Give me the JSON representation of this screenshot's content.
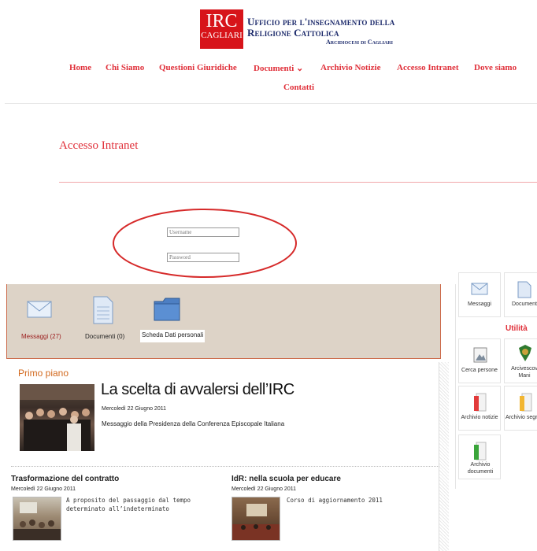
{
  "header": {
    "logo_irc": "IRC",
    "logo_city": "CAGLIARI",
    "title_line1": "Ufficio per l'insegnamento della",
    "title_line2": "Religione Cattolica",
    "title_line3": "Arcidiocesi di Cagliari"
  },
  "nav": {
    "home": "Home",
    "chi_siamo": "Chi Siamo",
    "questioni": "Questioni Giuridiche",
    "documenti": "Documenti ⌄",
    "archivio": "Archivio Notizie",
    "accesso": "Accesso Intranet",
    "dove": "Dove siamo",
    "contatti": "Contatti"
  },
  "page": {
    "title": "Accesso Intranet"
  },
  "login": {
    "username_placeholder": "Username",
    "password_placeholder": "Password"
  },
  "intranet": {
    "messaggi": "Messaggi (27)",
    "documenti": "Documenti (0)",
    "scheda": "Scheda Dati personali"
  },
  "main": {
    "section": "Primo piano",
    "featured": {
      "title": "La scelta di avvalersi dell’IRC",
      "date": "Mercoledì 22 Giugno 2011",
      "desc": "Messaggio della Presidenza della Conferenza Episcopale Italiana"
    },
    "articles": [
      {
        "title": "Trasformazione del contratto",
        "date": "Mercoledì 22 Giugno 2011",
        "desc": "A proposito del passaggio dal tempo determinato all’indeterminato"
      },
      {
        "title": "IdR: nella scuola per educare",
        "date": "Mercoledì 22 Giugno 2011",
        "desc": "Corso di aggiornamento 2011"
      }
    ]
  },
  "sidebar": {
    "messaggi": "Messaggi",
    "documenti": "Document",
    "utilita": "Utilità",
    "cerca": "Cerca persone",
    "arcivescovo": "Arcivescov Mani",
    "archivio_notizie": "Archivio notizie",
    "archivio_seg": "Archivio segr",
    "archivio_documenti": "Archivio documenti"
  },
  "colors": {
    "accent_red": "#e0303a",
    "logo_red": "#d7141a",
    "navy": "#1c2a6b",
    "panel_beige": "#ddd3c7",
    "section_orange": "#d2691e"
  }
}
